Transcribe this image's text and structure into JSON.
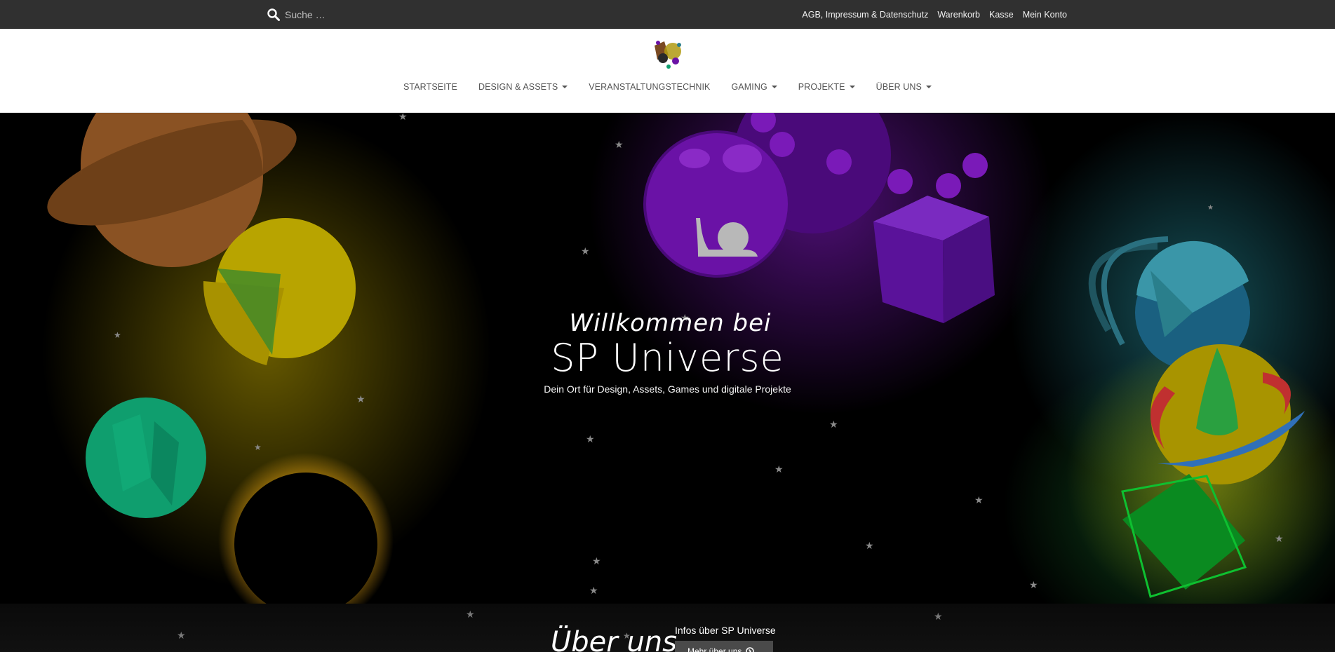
{
  "search": {
    "placeholder": "Suche …"
  },
  "top_links": [
    {
      "label": "AGB, Impressum & Datenschutz"
    },
    {
      "label": "Warenkorb"
    },
    {
      "label": "Kasse"
    },
    {
      "label": "Mein Konto"
    }
  ],
  "logo": {
    "alt": "SP Universe logo",
    "letters": "SP"
  },
  "nav": [
    {
      "label": "STARTSEITE",
      "dropdown": false
    },
    {
      "label": "DESIGN & ASSETS",
      "dropdown": true
    },
    {
      "label": "VERANSTALTUNGSTECHNIK",
      "dropdown": false
    },
    {
      "label": "GAMING",
      "dropdown": true
    },
    {
      "label": "PROJEKTE",
      "dropdown": true
    },
    {
      "label": "ÜBER UNS",
      "dropdown": true
    }
  ],
  "hero": {
    "pre": "Willkommen bei",
    "title": "SP Universe",
    "subtitle": "Dein Ort für Design, Assets, Games und digitale Projekte"
  },
  "about": {
    "title": "Über uns",
    "info": "Infos über SP Universe",
    "button": "Mehr über uns"
  },
  "colors": {
    "topbar": "#303030",
    "planet_orange": "#8a5223",
    "planet_yellow": "#b8a400",
    "planet_green": "#0f9e6e",
    "planet_purple": "#6a12a6",
    "planet_teal": "#2d7f8c"
  }
}
